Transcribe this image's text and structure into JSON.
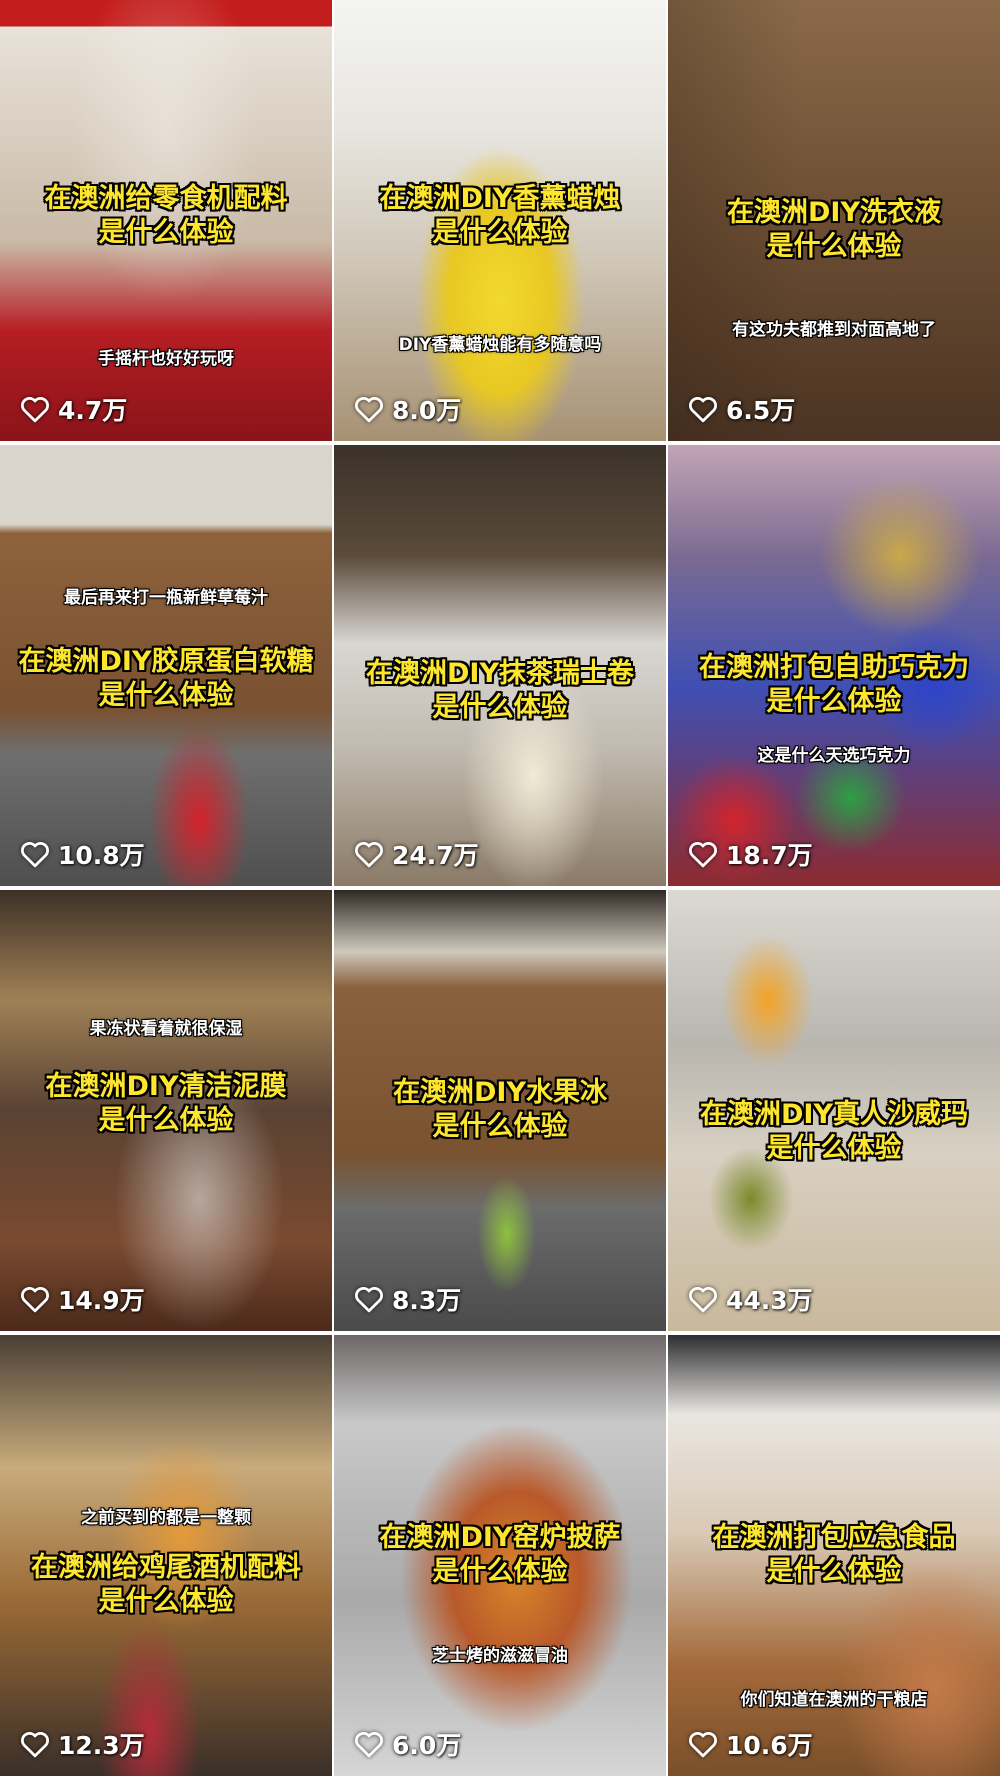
{
  "feed": {
    "tiles": [
      {
        "title1": "在澳洲给零食机配料",
        "title2": "是什么体验",
        "subtitle": "手摇杆也好好玩呀",
        "likes": "4.7万"
      },
      {
        "title1": "在澳洲DIY香薰蜡烛",
        "title2": "是什么体验",
        "subtitle": "DIY香薰蜡烛能有多随意吗",
        "likes": "8.0万"
      },
      {
        "title1": "在澳洲DIY洗衣液",
        "title2": "是什么体验",
        "subtitle": "有这功夫都推到对面高地了",
        "likes": "6.5万"
      },
      {
        "title1": "在澳洲DIY胶原蛋白软糖",
        "title2": "是什么体验",
        "subtitle": "最后再来打一瓶新鲜草莓汁",
        "likes": "10.8万"
      },
      {
        "title1": "在澳洲DIY抹茶瑞士卷",
        "title2": "是什么体验",
        "subtitle": "",
        "likes": "24.7万"
      },
      {
        "title1": "在澳洲打包自助巧克力",
        "title2": "是什么体验",
        "subtitle": "这是什么天选巧克力",
        "likes": "18.7万"
      },
      {
        "title1": "在澳洲DIY清洁泥膜",
        "title2": "是什么体验",
        "subtitle": "果冻状看着就很保湿",
        "likes": "14.9万"
      },
      {
        "title1": "在澳洲DIY水果冰",
        "title2": "是什么体验",
        "subtitle": "",
        "likes": "8.3万"
      },
      {
        "title1": "在澳洲DIY真人沙威玛",
        "title2": "是什么体验",
        "subtitle": "",
        "likes": "44.3万"
      },
      {
        "title1": "在澳洲给鸡尾酒机配料",
        "title2": "是什么体验",
        "subtitle": "之前买到的都是一整颗",
        "likes": "12.3万"
      },
      {
        "title1": "在澳洲DIY窑炉披萨",
        "title2": "是什么体验",
        "subtitle": "芝士烤的滋滋冒油",
        "likes": "6.0万"
      },
      {
        "title1": "在澳洲打包应急食品",
        "title2": "是什么体验",
        "subtitle": "你们知道在澳洲的干粮店",
        "likes": "10.6万"
      }
    ]
  },
  "colors": {
    "title_yellow": "#ffe62e",
    "text_white": "#ffffff"
  },
  "icons": {
    "like": "heart-outline-icon"
  }
}
